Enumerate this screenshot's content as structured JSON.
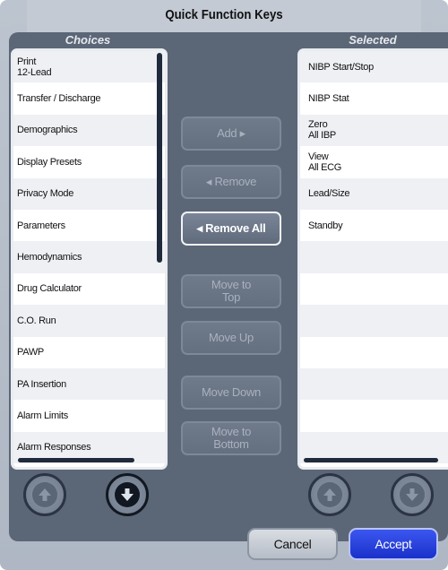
{
  "window": {
    "title": "Quick Function Keys"
  },
  "choices": {
    "header": "Choices",
    "items": [
      "Print\n12-Lead",
      "Transfer / Discharge",
      "Demographics",
      "Display Presets",
      "Privacy Mode",
      "Parameters",
      "Hemodynamics",
      "Drug Calculator",
      "C.O. Run",
      "PAWP",
      "PA Insertion",
      "Alarm Limits",
      "Alarm Responses"
    ]
  },
  "selected": {
    "header": "Selected",
    "items": [
      "NIBP Start/Stop",
      "NIBP Stat",
      "Zero\nAll IBP",
      "View\nAll ECG",
      "Lead/Size",
      "Standby",
      "",
      "",
      "",
      "",
      "",
      "",
      ""
    ]
  },
  "actions": {
    "add": "Add ▸",
    "remove": "◂ Remove",
    "remove_all": "◂ Remove All",
    "move_top": "Move to\nTop",
    "move_up": "Move Up",
    "move_down": "Move Down",
    "move_bottom": "Move to\nBottom"
  },
  "footer": {
    "cancel": "Cancel",
    "accept": "Accept"
  },
  "icons": {
    "left_up": "arrow-up-icon",
    "left_down": "arrow-down-icon",
    "right_up": "arrow-up-icon",
    "right_down": "arrow-down-icon"
  },
  "colors": {
    "accept": "#2440e0",
    "panel": "#5b6677"
  }
}
